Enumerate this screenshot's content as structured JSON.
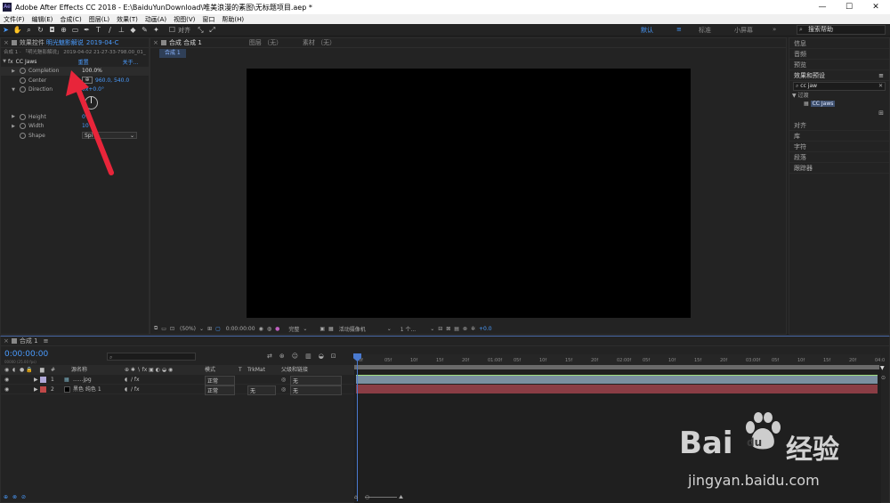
{
  "title_bar": {
    "logo_text": "Ae",
    "title": "Adobe After Effects CC 2018 - E:\\BaiduYunDownload\\唯美浪漫的素图\\无标题项目.aep *",
    "min": "—",
    "max": "☐",
    "close": "✕"
  },
  "menu": [
    "文件(F)",
    "编辑(E)",
    "合成(C)",
    "图层(L)",
    "效果(T)",
    "动画(A)",
    "视图(V)",
    "窗口",
    "帮助(H)"
  ],
  "toolbar": {
    "align_label": "对齐",
    "workspaces": [
      "默认",
      "标准",
      "小屏幕"
    ],
    "active_workspace": "默认",
    "more": "»",
    "search_placeholder": "搜索帮助"
  },
  "effect_controls": {
    "tab_label": "效果控件",
    "tab_target": "明光魅影解说",
    "tab_date": "2019-04-C",
    "path": "合成 1 · 「明光魅影解说」 2019-04-02 21-27-33-798.00_01_",
    "effect_name": "CC Jaws",
    "reset_label": "重置",
    "about_label": "关于...",
    "props": [
      {
        "name": "Completion",
        "value": "100.0%"
      },
      {
        "name": "Center",
        "value": "960.0, 540.0"
      },
      {
        "name": "Direction",
        "value": "0x+0.0°"
      },
      {
        "name": "Height",
        "value": "0%"
      },
      {
        "name": "Width",
        "value": "10"
      },
      {
        "name": "Shape",
        "value": "Spi"
      }
    ]
  },
  "viewer": {
    "tabs": [
      {
        "label": "合成 合成 1",
        "active": true
      },
      {
        "label": "图层 （无）",
        "active": false
      },
      {
        "label": "素材 （无）",
        "active": false
      }
    ],
    "breadcrumb": "合成 1",
    "zoom": "(50%)",
    "timecode": "0:00:00:00",
    "resolution": "完整",
    "camera": "活动摄像机",
    "views": "1 个...",
    "exposure": "+0.0"
  },
  "right_panels": {
    "items_top": [
      "信息",
      "音频",
      "预览"
    ],
    "effects_title": "效果和预设",
    "effects_search": "cc jaw",
    "tree_category": "过渡",
    "tree_item": "CC Jaws",
    "items_bottom": [
      "对齐",
      "库",
      "字符",
      "段落",
      "跟踪器"
    ]
  },
  "timeline": {
    "tab_label": "合成 1",
    "timecode": "0:00:00:00",
    "fps_note": "00000 (25.00 fps)",
    "columns": {
      "name": "源名称",
      "mode": "模式",
      "t": "T",
      "trkmat": "TrkMat",
      "parent": "父级和链接"
    },
    "layers": [
      {
        "num": "1",
        "name": "......jpg",
        "color": "#b0a8d8",
        "mode": "正常",
        "trkmat": "",
        "parent": "无"
      },
      {
        "num": "2",
        "name": "黑色 纯色 1",
        "color": "#c04848",
        "mode": "正常",
        "trkmat": "无",
        "parent": "无"
      }
    ],
    "ruler_ticks": [
      "0f",
      "05f",
      "10f",
      "15f",
      "20f",
      "01:00f",
      "05f",
      "10f",
      "15f",
      "20f",
      "02:00f",
      "05f",
      "10f",
      "15f",
      "20f",
      "03:00f",
      "05f",
      "10f",
      "15f",
      "20f",
      "04:0"
    ],
    "bar_colors": {
      "layer1": "#7a8fa0",
      "layer2": "#8a3d45"
    }
  },
  "watermark": {
    "brand": "Bai",
    "brand2": "du",
    "cn": "经验",
    "url": "jingyan.baidu.com"
  },
  "annotation_arrow_color": "#e8253a"
}
